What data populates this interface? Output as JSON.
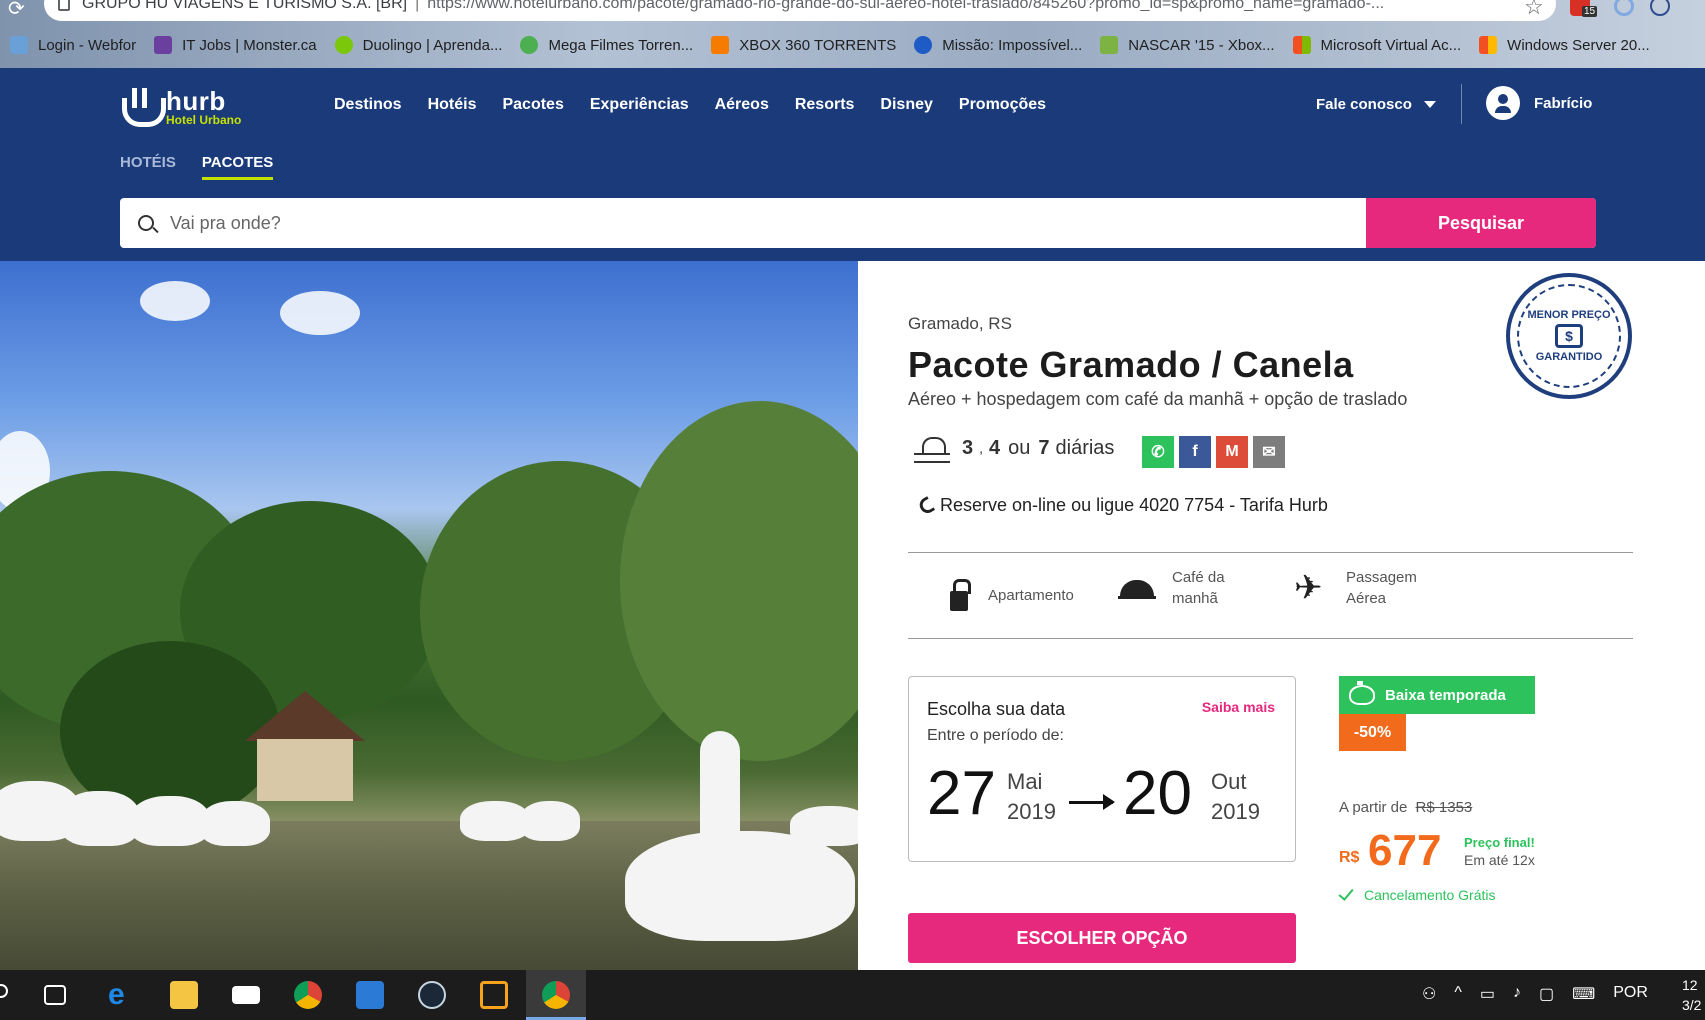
{
  "browser": {
    "org": "GRUPO HU VIAGENS E TURISMO S.A. [BR]",
    "separator": "|",
    "url": "https://www.hotelurbano.com/pacote/gramado-rio-grande-do-sul-aereo-hotel-traslado/845260?promo_id=sp&promo_name=gramado-...",
    "ext_badge": "15",
    "bookmarks": [
      {
        "label": "Login - Webfor",
        "color": "#6aa0d8"
      },
      {
        "label": "IT Jobs | Monster.ca",
        "color": "#6b3fa0"
      },
      {
        "label": "Duolingo | Aprenda...",
        "color": "#7ac70c"
      },
      {
        "label": "Mega Filmes Torren...",
        "color": "#4caf50"
      },
      {
        "label": "XBOX 360 TORRENTS",
        "color": "#f57c00"
      },
      {
        "label": "Missão: Impossível...",
        "color": "#1e5bc6"
      },
      {
        "label": "NASCAR '15 - Xbox...",
        "color": "#7cb342"
      },
      {
        "label": "Microsoft Virtual Ac...",
        "color": "#f25022"
      },
      {
        "label": "Windows Server 20...",
        "color": "#f25022"
      }
    ]
  },
  "header": {
    "brand": "hurb",
    "brand_sub": "Hotel Urbano",
    "nav": [
      "Destinos",
      "Hotéis",
      "Pacotes",
      "Experiências",
      "Aéreos",
      "Resorts",
      "Disney",
      "Promoções"
    ],
    "contact": "Fale conosco",
    "user_name": "Fabrício",
    "subtabs": [
      "HOTÉIS",
      "PACOTES"
    ],
    "search_placeholder": "Vai pra onde?",
    "search_button": "Pesquisar"
  },
  "product": {
    "location": "Gramado, RS",
    "title": "Pacote Gramado / Canela",
    "subtitle": "Aéreo + hospedagem com café da manhã + opção de traslado",
    "seal_line1": "MENOR PREÇO",
    "seal_line2": "GARANTIDO",
    "seal_symbol": "$",
    "nights_a": "3",
    "nights_sep": ",",
    "nights_b": "4",
    "nights_or": "ou",
    "nights_c": "7",
    "nights_unit": "diárias",
    "share": [
      {
        "name": "whatsapp",
        "glyph": "✆",
        "color": "#2ec25d"
      },
      {
        "name": "facebook",
        "glyph": "f",
        "color": "#3b5998"
      },
      {
        "name": "gmail",
        "glyph": "M",
        "color": "#dd4b39"
      },
      {
        "name": "email",
        "glyph": "✉",
        "color": "#7d7d7d"
      }
    ],
    "phone_text": "Reserve on-line ou ligue 4020 7754 - Tarifa Hurb",
    "features": [
      {
        "label": "Apartamento",
        "icon": "lock-icon"
      },
      {
        "label": "Café da manhã",
        "line1": "Café da",
        "line2": "manhã",
        "icon": "cloche-icon"
      },
      {
        "label": "Passagem Aérea",
        "line1": "Passagem",
        "line2": "Aérea",
        "icon": "plane-icon"
      }
    ],
    "date_card": {
      "heading": "Escolha sua data",
      "more": "Saiba mais",
      "period_label": "Entre o período de:",
      "start_day": "27",
      "start_month": "Mai",
      "start_year": "2019",
      "end_day": "20",
      "end_month": "Out",
      "end_year": "2019"
    },
    "badge_season": "Baixa temporada",
    "badge_discount": "-50%",
    "price_from_label": "A partir de",
    "price_old": "R$ 1353",
    "price_currency": "R$",
    "price_value": "677",
    "price_final": "Preço final!",
    "price_installments": "Em até 12x",
    "cancel_text": "Cancelamento Grátis",
    "cta": "ESCOLHER OPÇÃO"
  },
  "taskbar": {
    "language": "POR",
    "clock_line1": "12",
    "clock_line2": "3/2"
  },
  "colors": {
    "header_bg": "#1a3a7a",
    "accent_pink": "#e6297c",
    "accent_green": "#2ec25d",
    "accent_orange": "#f26b1d",
    "brand_lime": "#c6e000"
  }
}
